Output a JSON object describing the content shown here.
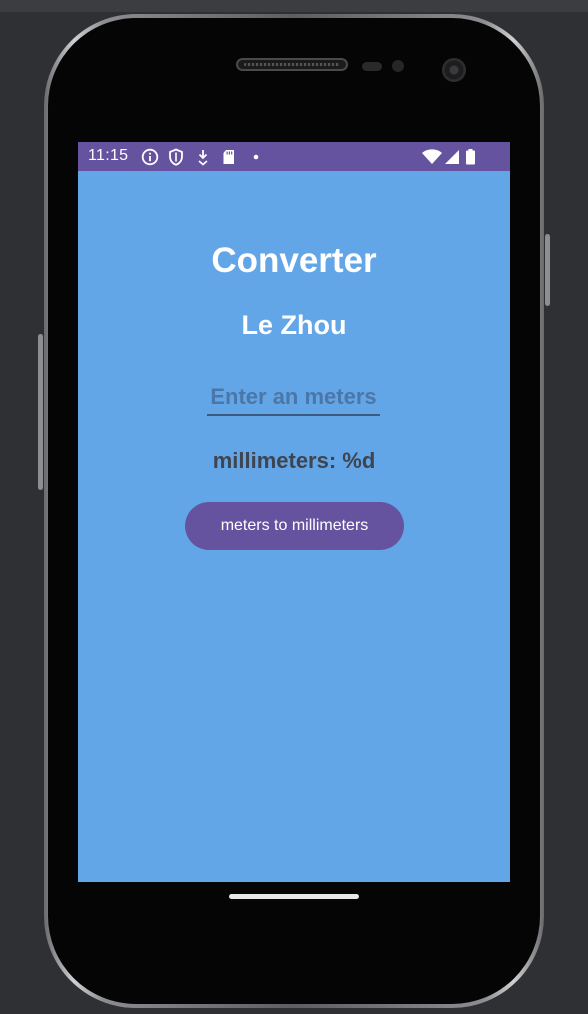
{
  "status_bar": {
    "time": "11:15",
    "left_icons": [
      "info-icon",
      "shield-icon",
      "download-icon",
      "sd-card-icon",
      "dot-icon"
    ],
    "right_icons": [
      "wifi-icon",
      "signal-icon",
      "battery-icon"
    ],
    "color": "#6653a0"
  },
  "app": {
    "background": "#63a6e8",
    "title": "Converter",
    "subtitle": "Le Zhou",
    "meters_input": {
      "value": "",
      "placeholder": "Enter an meters"
    },
    "result_label": "millimeters: %d",
    "convert_button_label": "meters to millimeters",
    "accent": "#6653a0"
  },
  "navigation": {
    "home_handle": "home-gesture-handle"
  }
}
